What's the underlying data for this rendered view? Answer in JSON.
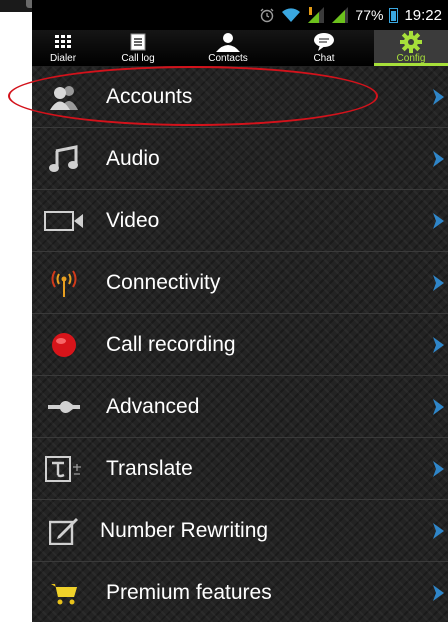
{
  "status_bar": {
    "battery_percent": "77%",
    "time": "19:22",
    "icons": [
      "alarm-icon",
      "wifi-icon",
      "signal-icon",
      "signal-icon",
      "battery-icon"
    ]
  },
  "tabs": [
    {
      "label": "Dialer",
      "icon": "dialpad-icon",
      "active": false
    },
    {
      "label": "Call log",
      "icon": "call-log-icon",
      "active": false
    },
    {
      "label": "Contacts",
      "icon": "contacts-icon",
      "active": false
    },
    {
      "label": "Chat",
      "icon": "chat-icon",
      "active": false
    },
    {
      "label": "Config",
      "icon": "gear-icon",
      "active": true
    }
  ],
  "menu": {
    "items": [
      {
        "label": "Accounts",
        "icon": "accounts-icon"
      },
      {
        "label": "Audio",
        "icon": "music-note-icon"
      },
      {
        "label": "Video",
        "icon": "video-camera-icon"
      },
      {
        "label": "Connectivity",
        "icon": "antenna-icon"
      },
      {
        "label": "Call recording",
        "icon": "record-icon"
      },
      {
        "label": "Advanced",
        "icon": "wrench-icon"
      },
      {
        "label": "Translate",
        "icon": "translate-icon"
      },
      {
        "label": "Number Rewriting",
        "icon": "edit-icon"
      },
      {
        "label": "Premium features",
        "icon": "cart-icon"
      }
    ],
    "highlighted_item": "Accounts"
  },
  "colors": {
    "accent_green": "#a7e03a",
    "chevron_blue": "#2f86c9",
    "highlight_red": "#d3121b",
    "battery_blue": "#3aa7e0"
  }
}
